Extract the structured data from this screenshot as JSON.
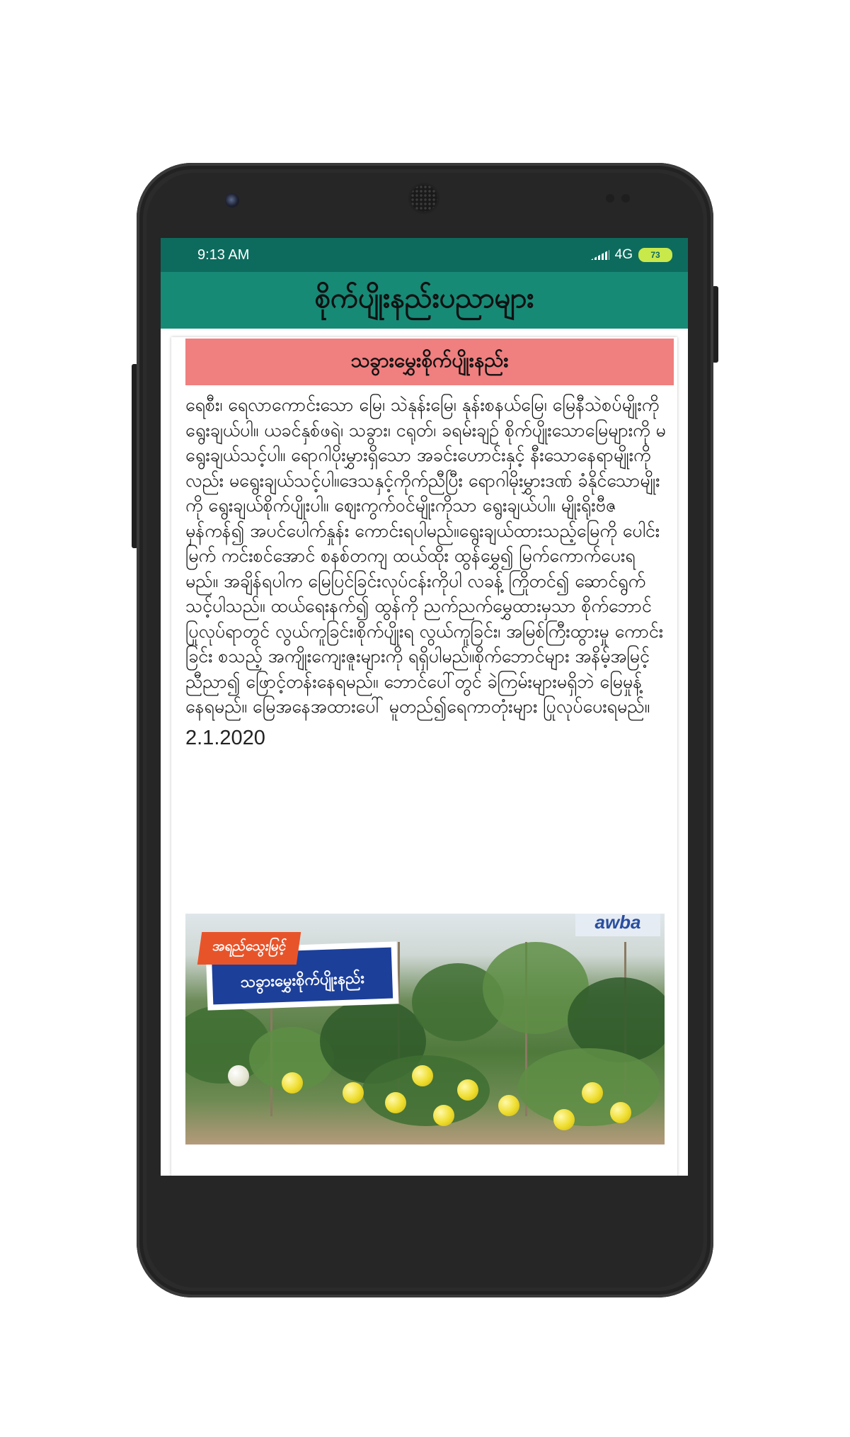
{
  "status_bar": {
    "time": "9:13 AM",
    "network": "4G",
    "battery": "73"
  },
  "app_bar": {
    "title": "စိုက်ပျိုးနည်းပညာများ"
  },
  "article": {
    "title": "သခွားမွှေးစိုက်ပျိုးနည်း",
    "body": "ရေစီး၊ ရေလာကောင်းသော မြေ၊ သဲနုန်းမြေ၊ နုန်းစနယ်မြေ၊ မြေနီသဲစပ်မျိုးကို ရွေးချယ်ပါ။ ယခင်နှစ်ဖရဲ၊ သခွား၊ ငရုတ်၊ ခရမ်းချဉ် စိုက်ပျိုးသောမြေများကို မရွေးချယ်သင့်ပါ။ ရောဂါပိုးမွှားရှိသော အခင်းဟောင်းနှင့် နီးသောနေရာမျိုးကိုလည်း မရွေးချယ်သင့်ပါ။ဒေသနှင့်ကိုက်ညီပြီး ရောဂါမိုးမွှားဒဏ် ခံနိုင်သောမျိုးကို ရွေးချယ်စိုက်ပျိုးပါ။ ဈေးကွက်ဝင်မျိုးကိုသာ ရွေးချယ်ပါ။ မျိုးရိုးဗီဇ မှန်ကန်၍ အပင်ပေါက်နှုန်း ကောင်းရပါမည်။ရွေးချယ်ထားသည့်မြေကို ပေါင်းမြက် ကင်းစင်အောင် စနစ်တကျ ထယ်ထိုး ထွန်မွှေ၍ မြက်ကောက်ပေးရမည်။ အချိန်ရပါက မြေပြင်ခြင်းလုပ်ငန်းကိုပါ လခန့် ကြိုတင်၍ ဆောင်ရွက်သင့်ပါသည်။ ထယ်ရေးနက်၍ ထွန်ကို ညက်ညက်မွှေထားမှသာ စိုက်ဘောင် ပြုလုပ်ရာတွင် လွယ်ကူခြင်း၊စိုက်ပျိုးရ လွယ်ကူခြင်း၊ အမြစ်ကြီးထွားမှု ကောင်းခြင်း စသည့် အကျိုးကျေးဇူးများကို ရရှိပါမည်။စိုက်ဘောင်များ အနိမ့်အမြင့် ညီညာ၍ ဖြောင့်တန်းနေရမည်။ ဘောင်ပေါ်တွင် ခဲကြမ်းများမရှိဘဲ မြေမှုန့် နေရမည်။ မြေအနေအထားပေါ် မူတည်၍ရေကာတုံးများ ပြုလုပ်ပေးရမည်။",
    "date": "2.1.2020",
    "image": {
      "badge_small": "အရည်သွေးမြင့်",
      "badge_large": "သခွားမွှေးစိုက်ပျိုးနည်း",
      "brand": "awba"
    }
  },
  "colors": {
    "status_bar": "#0d6b5e",
    "app_bar": "#178a76",
    "title_bg": "#f07f7f"
  }
}
